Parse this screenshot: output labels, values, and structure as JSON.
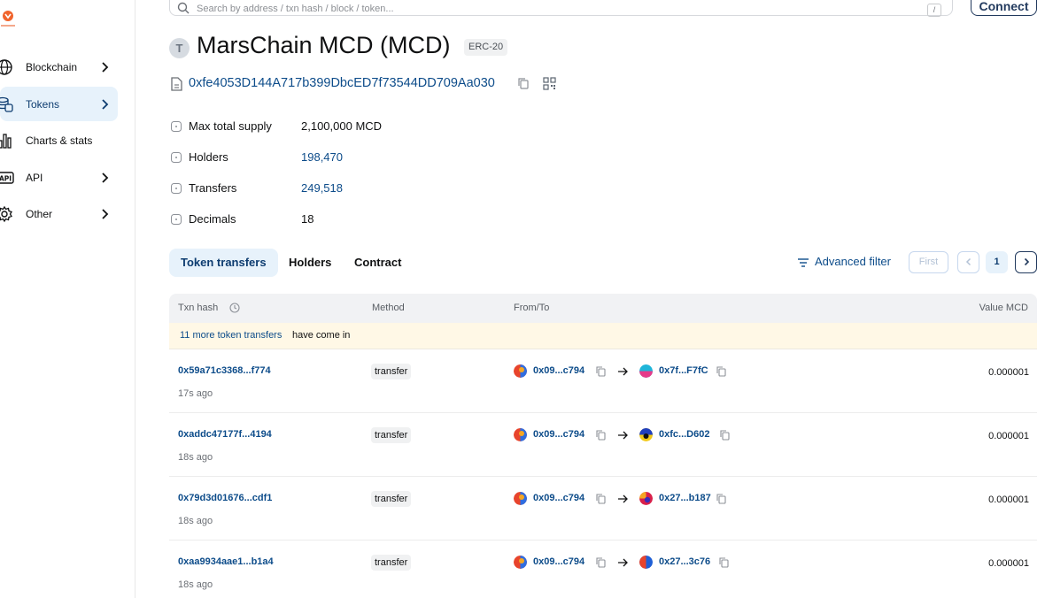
{
  "sidebar": {
    "items": [
      {
        "label": "Blockchain",
        "icon": "globe-icon",
        "chevron": true,
        "active": false
      },
      {
        "label": "Tokens",
        "icon": "coins-icon",
        "chevron": true,
        "active": true
      },
      {
        "label": "Charts & stats",
        "icon": "bar-chart-icon",
        "chevron": false,
        "active": false
      },
      {
        "label": "API",
        "icon": "api-icon",
        "chevron": true,
        "active": false
      },
      {
        "label": "Other",
        "icon": "gear-icon",
        "chevron": true,
        "active": false
      }
    ]
  },
  "search": {
    "placeholder": "Search by address / txn hash / block / token...",
    "shortcut": "/"
  },
  "header": {
    "connect_label": "Connect",
    "avatar_letter": "T",
    "title": "MarsChain MCD (MCD)",
    "badge": "ERC-20",
    "address": "0xfe4053D144A717b399DbcED7f73544DD709Aa030"
  },
  "details": [
    {
      "label": "Max total supply",
      "value": "2,100,000 MCD",
      "link": false
    },
    {
      "label": "Holders",
      "value": "198,470",
      "link": true
    },
    {
      "label": "Transfers",
      "value": "249,518",
      "link": true
    },
    {
      "label": "Decimals",
      "value": "18",
      "link": false
    }
  ],
  "tabs": [
    "Token transfers",
    "Holders",
    "Contract"
  ],
  "advanced_filter": "Advanced filter",
  "pagination": {
    "first": "First",
    "current": "1"
  },
  "table": {
    "columns": [
      "Txn hash",
      "Method",
      "From/To",
      "Value MCD"
    ],
    "notice_link": "11 more token transfers",
    "notice_text": "have come in",
    "rows": [
      {
        "hash": "0x59a71c3368...f774",
        "age": "17s ago",
        "method": "transfer",
        "from": "0x09...c794",
        "to": "0x7f...F7fC",
        "value": "0.000001"
      },
      {
        "hash": "0xaddc47177f...4194",
        "age": "18s ago",
        "method": "transfer",
        "from": "0x09...c794",
        "to": "0xfc...D602",
        "value": "0.000001"
      },
      {
        "hash": "0x79d3d01676...cdf1",
        "age": "18s ago",
        "method": "transfer",
        "from": "0x09...c794",
        "to": "0x27...b187",
        "value": "0.000001"
      },
      {
        "hash": "0xaa9934aae1...b1a4",
        "age": "18s ago",
        "method": "transfer",
        "from": "0x09...c794",
        "to": "0x27...3c76",
        "value": "0.000001"
      }
    ]
  },
  "colors": {
    "link": "#0d4c8a",
    "active_bg": "#e7f2fb",
    "notice_bg": "#fff8e6"
  }
}
